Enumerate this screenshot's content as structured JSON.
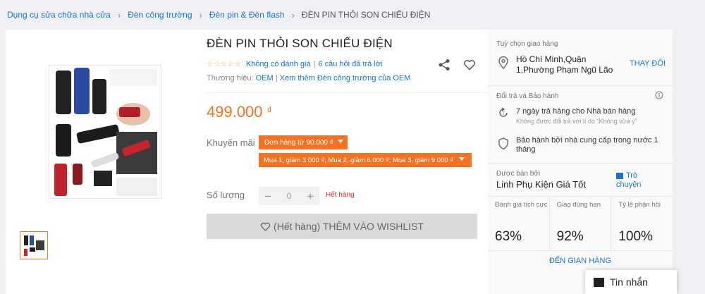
{
  "breadcrumb": [
    {
      "label": "Dụng cụ sửa chữa nhà cửa"
    },
    {
      "label": "Đèn công trường"
    },
    {
      "label": "Đèn pin & Đèn flash"
    },
    {
      "label": "ĐÈN PIN THỎI SON CHIẾU ĐIỆN"
    }
  ],
  "product": {
    "title": "ĐÈN PIN THỎI SON CHIẾU ĐIỆN",
    "rating_text": "Không có đánh giá",
    "qa_text": "6 câu hỏi đã trả lời",
    "brand_label": "Thương hiệu:",
    "brand": "OEM",
    "brand_more": "Xem thêm Đèn công trường của OEM",
    "price": "499.000",
    "currency": "₫"
  },
  "promo": {
    "label": "Khuyến mãi",
    "tag1": "Đơn hàng từ 90.000 ₫",
    "tag2": "Mua 1, giảm 3.000 ₫; Mua 2, giảm 6.000 ₫; Mua 3, giảm 9.000 ₫"
  },
  "quantity": {
    "label": "Số lượng",
    "minus": "−",
    "value": "0",
    "plus": "+",
    "status": "Hết hàng"
  },
  "wishlist": {
    "label": "(Hết hàng) THÊM VÀO WISHLIST"
  },
  "delivery": {
    "title": "Tuỳ chọn giao hàng",
    "location": "Hồ Chí Minh,Quận 1,Phường Phạm Ngũ Lão",
    "change": "THAY ĐỔI"
  },
  "returns": {
    "title": "Đổi trả và Bảo hành",
    "return_text": "7 ngày trả hàng cho Nhà bán hàng",
    "return_sub": "Không được đổi trả với lí do \"Không vừa ý\"",
    "warranty": "Bảo hành bởi nhà cung cấp trong nước 1 tháng"
  },
  "seller": {
    "sold_by": "Được bán bởi",
    "name": "Linh Phụ Kiện Giá Tốt",
    "chat": "Trò chuyện",
    "stats": [
      {
        "label": "Đánh giá tích cực",
        "value": "63%"
      },
      {
        "label": "Giao đúng hạn",
        "value": "92%"
      },
      {
        "label": "Tỷ lệ phản hồi",
        "value": "100%"
      }
    ],
    "store_link": "ĐẾN GIAN HÀNG"
  },
  "chat_float": {
    "label": "Tin nhắn"
  },
  "colors": {
    "accent": "#f57224",
    "link": "#1a73c9"
  }
}
